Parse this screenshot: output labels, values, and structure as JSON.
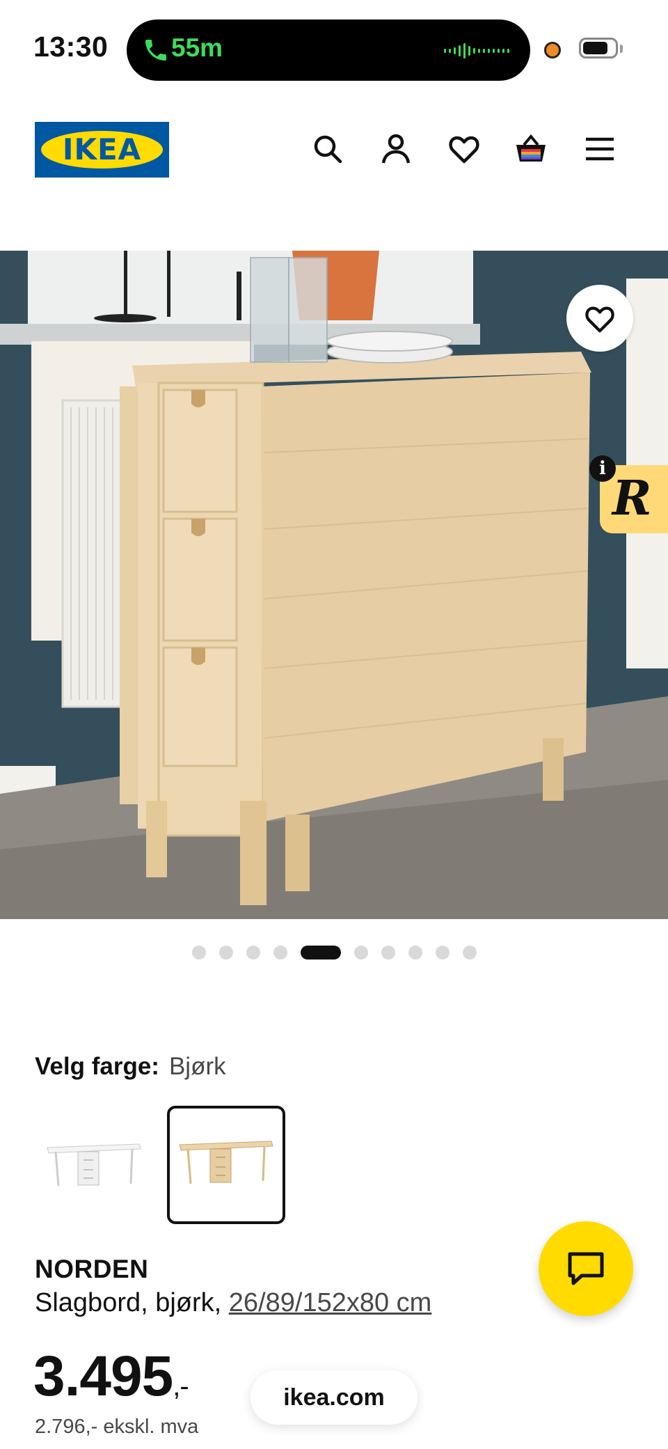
{
  "status_bar": {
    "time": "13:30",
    "call_duration": "55m"
  },
  "header": {
    "logo_text": "IKEA"
  },
  "carousel": {
    "total": 10,
    "active_index": 4
  },
  "color": {
    "label": "Velg farge:",
    "value": "Bjørk"
  },
  "product": {
    "name": "NORDEN",
    "desc_prefix": "Slagbord, bjørk, ",
    "size_link": "26/89/152x80 cm",
    "price_main": "3.495",
    "price_suffix": ",-",
    "price_ex_vat": "2.796,- ekskl. mva"
  },
  "browser": {
    "url": "ikea.com"
  },
  "colors": {
    "ikea_blue": "#0058a3",
    "ikea_yellow": "#ffdb00",
    "call_green": "#3ddc5a"
  }
}
